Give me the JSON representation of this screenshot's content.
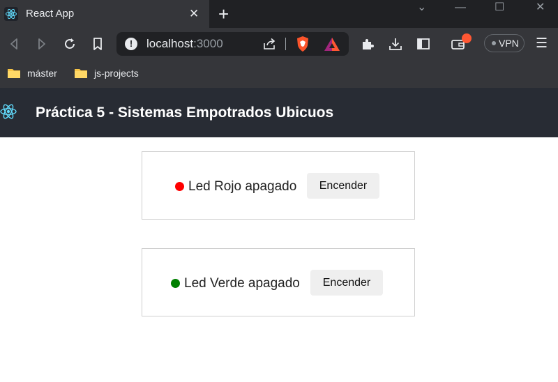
{
  "browser": {
    "tab_title": "React App",
    "tab_close": "✕",
    "new_tab": "+",
    "url_host": "localhost",
    "url_port": ":3000",
    "vpn_label": "VPN",
    "menu_glyph": "☰",
    "window_controls": [
      "⌄",
      "—",
      "☐",
      "✕"
    ],
    "bookmarks": [
      {
        "label": "máster",
        "icon": "folder-icon"
      },
      {
        "label": "js-projects",
        "icon": "folder-icon"
      }
    ],
    "accent_colors": {
      "brave": "#fb542b",
      "rewards": "#a1267d",
      "badge": "#ff5733"
    }
  },
  "app": {
    "title": "Práctica 5 - Sistemas Empotrados Ubicuos",
    "logo": "react-logo-icon"
  },
  "leds": [
    {
      "label": "Led Rojo apagado",
      "color": "#ff0000",
      "button": "Encender"
    },
    {
      "label": "Led Verde apagado",
      "color": "#008000",
      "button": "Encender"
    }
  ]
}
